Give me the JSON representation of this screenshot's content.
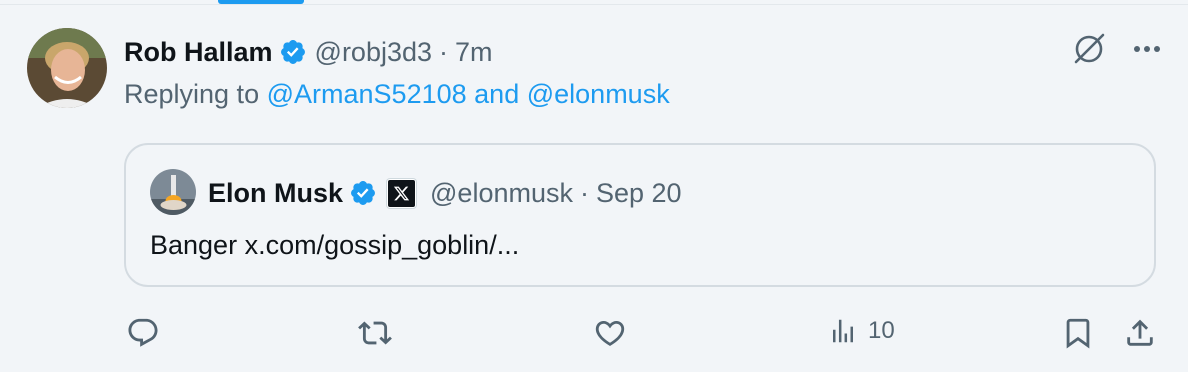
{
  "post": {
    "author_name": "Rob Hallam",
    "handle": "@robj3d3",
    "separator": "·",
    "time": "7m",
    "replying_prefix": "Replying to",
    "replying_to_1": "@ArmanS52108",
    "replying_joiner": "and",
    "replying_to_2": "@elonmusk"
  },
  "quote": {
    "author_name": "Elon Musk",
    "handle": "@elonmusk",
    "separator": "·",
    "time": "Sep 20",
    "text": "Banger x.com/gossip_goblin/..."
  },
  "actions": {
    "views": "10"
  },
  "icons": {
    "header": [
      "grok-icon",
      "more-icon"
    ],
    "actions": [
      "reply-icon",
      "repost-icon",
      "like-icon",
      "views-icon",
      "bookmark-icon",
      "share-icon"
    ]
  },
  "colors": {
    "accent": "#1d9bf0",
    "text_primary": "#0f1419",
    "text_secondary": "#536471",
    "background": "#f2f5f8",
    "border": "#d4dbe1"
  }
}
